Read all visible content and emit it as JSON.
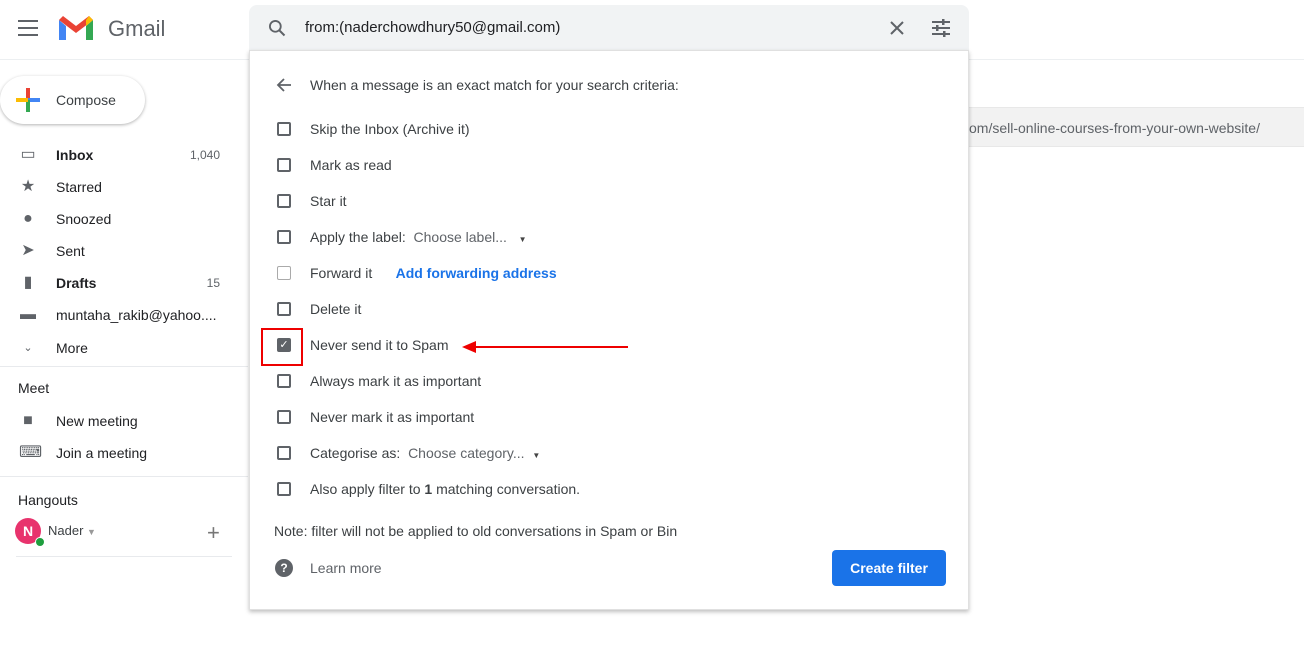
{
  "app": {
    "name": "Gmail"
  },
  "compose": "Compose",
  "nav": [
    {
      "label": "Inbox",
      "count": "1,040",
      "bold": true,
      "icon": "inbox-icon"
    },
    {
      "label": "Starred",
      "icon": "star-icon"
    },
    {
      "label": "Snoozed",
      "icon": "clock-icon"
    },
    {
      "label": "Sent",
      "icon": "send-icon"
    },
    {
      "label": "Drafts",
      "count": "15",
      "bold": true,
      "icon": "draft-icon"
    },
    {
      "label": "muntaha_rakib@yahoo....",
      "icon": "label-icon"
    },
    {
      "label": "More",
      "icon": "chevron-down-icon"
    }
  ],
  "meet": {
    "title": "Meet",
    "items": [
      "New meeting",
      "Join a meeting"
    ]
  },
  "hangouts": {
    "title": "Hangouts",
    "user": "Nader",
    "initial": "N"
  },
  "search": {
    "query": "from:(naderchowdhury50@gmail.com)"
  },
  "filter": {
    "heading": "When a message is an exact match for your search criteria:",
    "options": [
      {
        "label": "Skip the Inbox (Archive it)",
        "checked": false
      },
      {
        "label": "Mark as read",
        "checked": false
      },
      {
        "label": "Star it",
        "checked": false
      },
      {
        "label": "Apply the label:",
        "checked": false,
        "select": "Choose label..."
      },
      {
        "label": "Forward it",
        "checked": false,
        "link": "Add forwarding address"
      },
      {
        "label": "Delete it",
        "checked": false
      },
      {
        "label": "Never send it to Spam",
        "checked": true
      },
      {
        "label": "Always mark it as important",
        "checked": false
      },
      {
        "label": "Never mark it as important",
        "checked": false
      },
      {
        "label": "Categorise as:",
        "checked": false,
        "select": "Choose category..."
      },
      {
        "label": "Also apply filter to ",
        "bold_part": "1",
        "suffix": " matching conversation.",
        "checked": false
      }
    ],
    "note": "Note: filter will not be applied to old conversations in Spam or Bin",
    "learn_more": "Learn more",
    "create": "Create filter"
  },
  "background_url": "om/sell-online-courses-from-your-own-website/",
  "colors": {
    "accent": "#1a73e8",
    "annotation": "#e00000"
  }
}
